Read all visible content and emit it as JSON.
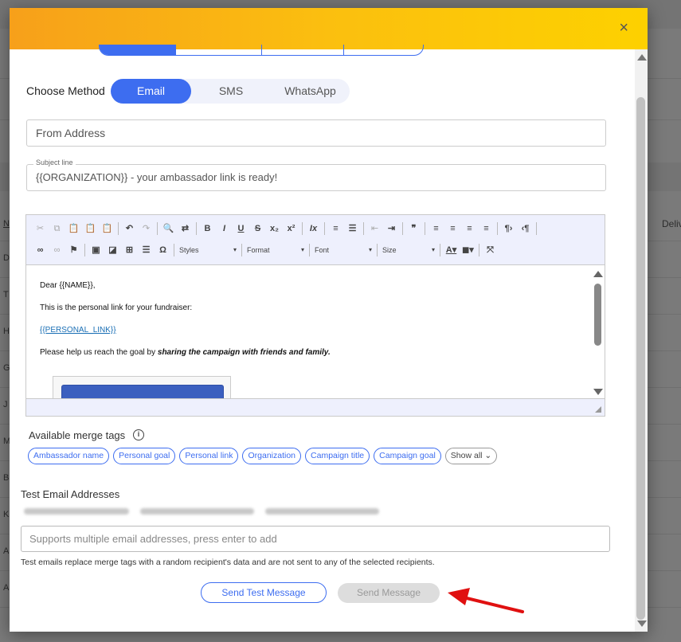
{
  "background": {
    "row_letters": [
      "N",
      "D",
      "T",
      "H",
      "G",
      "J",
      "M",
      "B",
      "K",
      "A",
      "A"
    ],
    "column_header_right": "Deliv"
  },
  "modal": {
    "close_glyph": "×",
    "method": {
      "label": "Choose Method",
      "options": [
        "Email",
        "SMS",
        "WhatsApp"
      ],
      "selected": "Email"
    },
    "from_address": {
      "placeholder": "From Address"
    },
    "subject": {
      "legend": "Subject line",
      "value": "{{ORGANIZATION}} - your ambassador link is ready!"
    },
    "editor": {
      "toolbar_combos": {
        "styles": "Styles",
        "format": "Format",
        "font": "Font",
        "size": "Size"
      },
      "body": {
        "greeting": "Dear {{NAME}},",
        "line1": "This is the personal link for your fundraiser:",
        "link": "{{PERSONAL_LINK}}",
        "line3_prefix": "Please help us reach the goal by ",
        "line3_emphasis": "sharing the campaign with friends and family."
      }
    },
    "merge_tags": {
      "label": "Available merge tags",
      "tags": [
        "Ambassador name",
        "Personal goal",
        "Personal link",
        "Organization",
        "Campaign title",
        "Campaign goal"
      ],
      "show_all": "Show all"
    },
    "test_emails": {
      "label": "Test Email Addresses",
      "input_placeholder": "Supports multiple email addresses, press enter to add",
      "helper": "Test emails replace merge tags with a random recipient's data and are not sent to any of the selected recipients."
    },
    "buttons": {
      "send_test": "Send Test Message",
      "send": "Send Message"
    }
  },
  "colors": {
    "accent": "#3d6df0",
    "header_gradient_start": "#f7a01a",
    "header_gradient_end": "#fdd100",
    "annotation_arrow": "#e01010"
  }
}
